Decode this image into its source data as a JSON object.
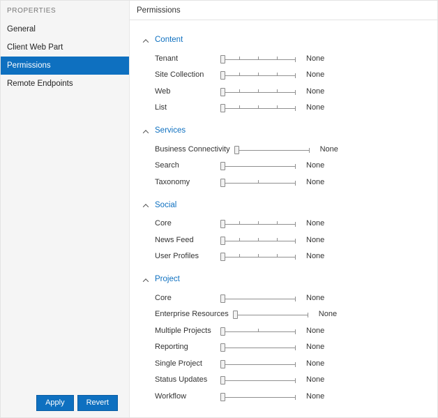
{
  "colors": {
    "accent": "#0e70c0",
    "link": "#0072c6"
  },
  "sidebar": {
    "header": "PROPERTIES",
    "items": [
      {
        "label": "General",
        "selected": false
      },
      {
        "label": "Client Web Part",
        "selected": false
      },
      {
        "label": "Permissions",
        "selected": true
      },
      {
        "label": "Remote Endpoints",
        "selected": false
      }
    ],
    "apply_label": "Apply",
    "revert_label": "Revert"
  },
  "main": {
    "title": "Permissions",
    "sections": [
      {
        "title": "Content",
        "rows": [
          {
            "label": "Tenant",
            "value": "None",
            "positions": 5
          },
          {
            "label": "Site Collection",
            "value": "None",
            "positions": 5
          },
          {
            "label": "Web",
            "value": "None",
            "positions": 5
          },
          {
            "label": "List",
            "value": "None",
            "positions": 5
          }
        ]
      },
      {
        "title": "Services",
        "rows": [
          {
            "label": "Business Connectivity",
            "value": "None",
            "positions": 2
          },
          {
            "label": "Search",
            "value": "None",
            "positions": 2
          },
          {
            "label": "Taxonomy",
            "value": "None",
            "positions": 3
          }
        ]
      },
      {
        "title": "Social",
        "rows": [
          {
            "label": "Core",
            "value": "None",
            "positions": 5
          },
          {
            "label": "News Feed",
            "value": "None",
            "positions": 5
          },
          {
            "label": "User Profiles",
            "value": "None",
            "positions": 5
          }
        ]
      },
      {
        "title": "Project",
        "rows": [
          {
            "label": "Core",
            "value": "None",
            "positions": 2
          },
          {
            "label": "Enterprise Resources",
            "value": "None",
            "positions": 2
          },
          {
            "label": "Multiple Projects",
            "value": "None",
            "positions": 3
          },
          {
            "label": "Reporting",
            "value": "None",
            "positions": 2
          },
          {
            "label": "Single Project",
            "value": "None",
            "positions": 2
          },
          {
            "label": "Status Updates",
            "value": "None",
            "positions": 2
          },
          {
            "label": "Workflow",
            "value": "None",
            "positions": 2
          }
        ]
      }
    ]
  }
}
